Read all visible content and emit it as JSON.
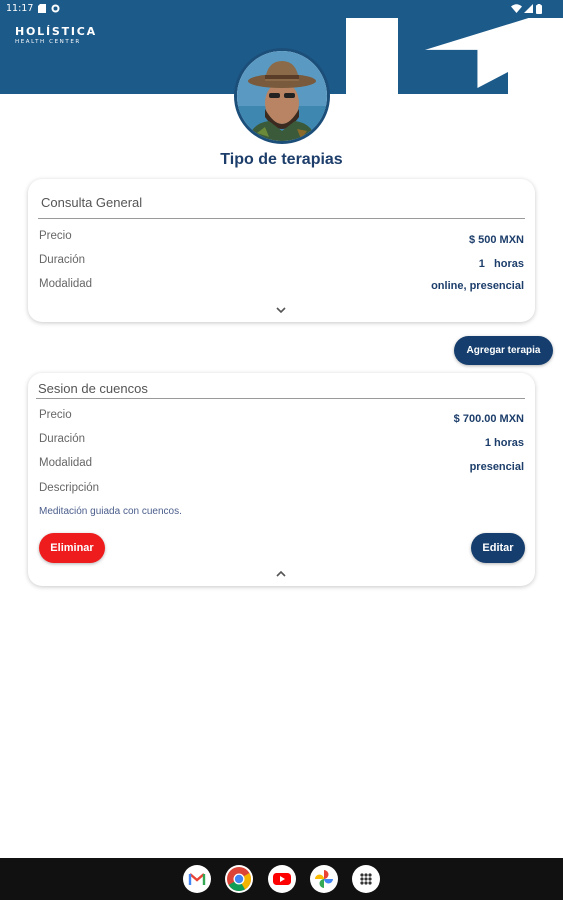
{
  "status_bar": {
    "time": "11:17"
  },
  "brand": {
    "line1": "HOLÍSTICA",
    "line2": "HEALTH CENTER"
  },
  "page": {
    "title": "Tipo de terapias"
  },
  "therapies": [
    {
      "title": "Consulta General",
      "price_label": "Precio",
      "price": "$ 500 MXN",
      "duration_label": "Duración",
      "duration": "1   horas",
      "mode_label": "Modalidad",
      "mode": "online, presencial",
      "expanded": false
    },
    {
      "title": "Sesion de cuencos",
      "price_label": "Precio",
      "price": "$ 700.00 MXN",
      "duration_label": "Duración",
      "duration": "1 horas",
      "mode_label": "Modalidad",
      "mode": "presencial",
      "description_label": "Descripción",
      "description": "Meditación guiada con cuencos.",
      "delete_label": "Eliminar",
      "edit_label": "Editar",
      "expanded": true
    }
  ],
  "actions": {
    "add_label": "Agregar terapia"
  },
  "colors": {
    "primary": "#1c5a8a",
    "navy": "#153e6e",
    "danger": "#ee1c1c"
  },
  "dock_apps": [
    "gmail-icon",
    "chrome-icon",
    "youtube-icon",
    "photos-icon",
    "app-drawer-icon"
  ]
}
